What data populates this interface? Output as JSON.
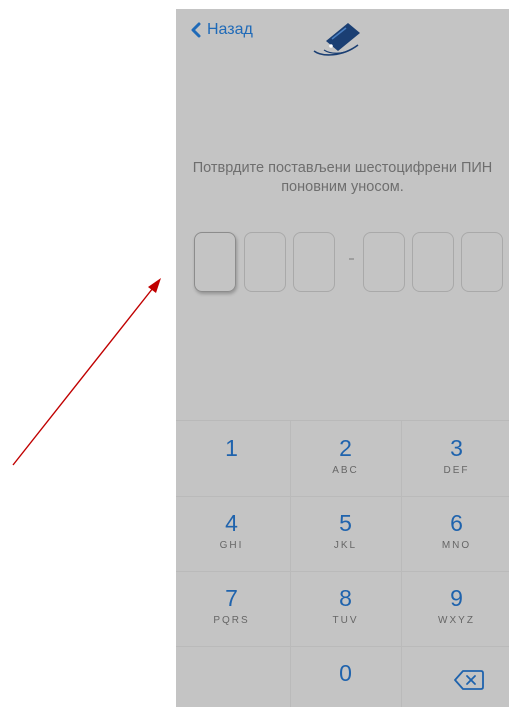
{
  "header": {
    "back_label": "Назад",
    "logo": "card-logo-icon"
  },
  "instruction": {
    "line1": "Потврдите постављени шестоцифрени ПИН",
    "line2": "поновним уносом."
  },
  "pin": {
    "length": 6,
    "separator": "-",
    "active_index": 0
  },
  "keypad": {
    "keys": [
      {
        "digit": "1",
        "letters": ""
      },
      {
        "digit": "2",
        "letters": "ABC"
      },
      {
        "digit": "3",
        "letters": "DEF"
      },
      {
        "digit": "4",
        "letters": "GHI"
      },
      {
        "digit": "5",
        "letters": "JKL"
      },
      {
        "digit": "6",
        "letters": "MNO"
      },
      {
        "digit": "7",
        "letters": "PQRS"
      },
      {
        "digit": "8",
        "letters": "TUV"
      },
      {
        "digit": "9",
        "letters": "WXYZ"
      },
      {
        "digit": "0",
        "letters": ""
      }
    ],
    "backspace": "backspace-icon"
  },
  "colors": {
    "accent": "#1f6ab8",
    "screen_bg": "#c4c4c4",
    "annotation_arrow": "#c00000"
  }
}
